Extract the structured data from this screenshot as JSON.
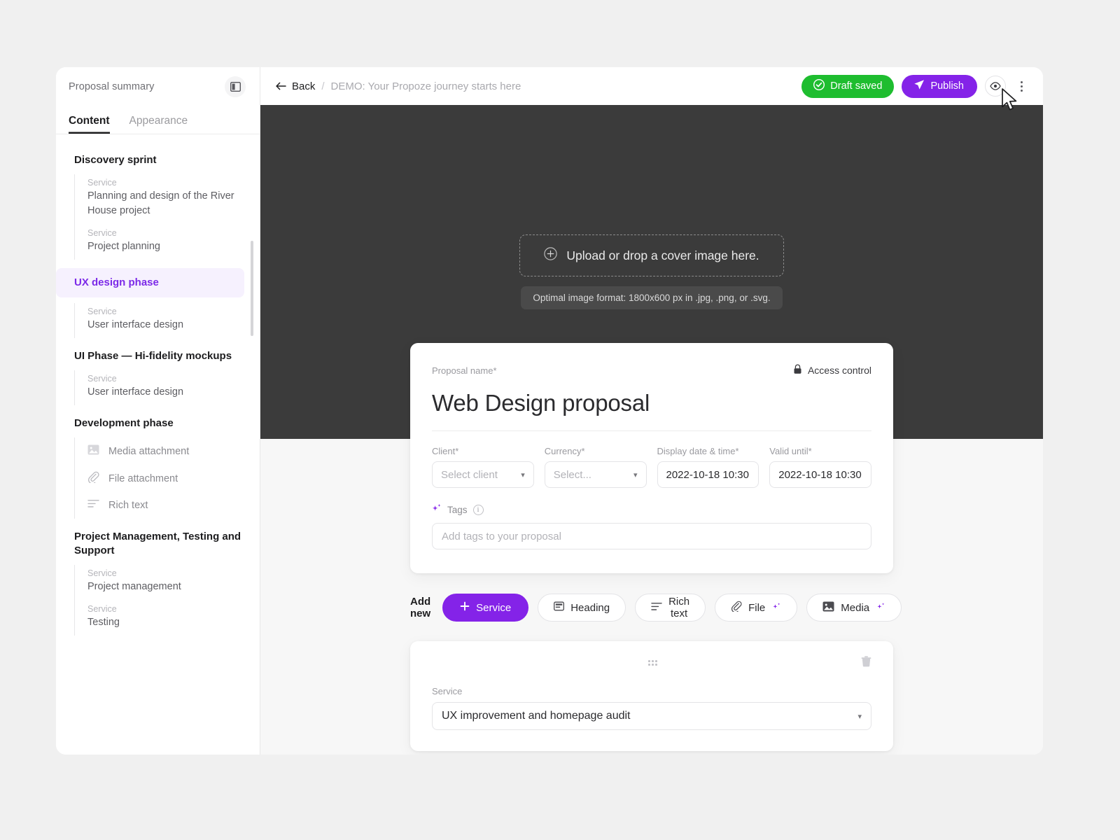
{
  "sidebar": {
    "title": "Proposal summary",
    "panel_toggle_icon": "panel-layout-icon",
    "tabs": [
      {
        "label": "Content",
        "active": true
      },
      {
        "label": "Appearance",
        "active": false
      }
    ],
    "groups": [
      {
        "title": "Discovery sprint",
        "active": false,
        "items": [
          {
            "kind": "Service",
            "name": "Planning and design of the River House project"
          },
          {
            "kind": "Service",
            "name": "Project planning"
          }
        ]
      },
      {
        "title": "UX design phase",
        "active": true,
        "items": [
          {
            "kind": "Service",
            "name": "User interface design"
          }
        ]
      },
      {
        "title": "UI Phase — Hi-fidelity mockups",
        "active": false,
        "items": [
          {
            "kind": "Service",
            "name": "User interface design"
          }
        ]
      },
      {
        "title": "Development phase",
        "active": false,
        "blocks": [
          {
            "icon": "image-icon",
            "label": "Media attachment"
          },
          {
            "icon": "paperclip-icon",
            "label": "File attachment"
          },
          {
            "icon": "text-lines-icon",
            "label": "Rich text"
          }
        ]
      },
      {
        "title": "Project Management, Testing and Support",
        "active": false,
        "items": [
          {
            "kind": "Service",
            "name": "Project management"
          },
          {
            "kind": "Service",
            "name": "Testing"
          }
        ]
      }
    ]
  },
  "topbar": {
    "back_label": "Back",
    "separator": "/",
    "breadcrumb_current": "DEMO: Your Propoze journey starts here",
    "draft_label": "Draft saved",
    "publish_label": "Publish",
    "preview_icon": "eye-icon",
    "more_icon": "kebab-menu-icon",
    "draft_color": "#1ebd2f",
    "publish_color": "#8423e8"
  },
  "cover": {
    "upload_label": "Upload or drop a cover image here.",
    "upload_icon": "plus-circle-icon",
    "hint": "Optimal image format: 1800x600 px in .jpg, .png, or .svg.",
    "background_color": "#3b3b3b"
  },
  "proposal": {
    "name_label": "Proposal name*",
    "name_value": "Web Design proposal",
    "access_control_label": "Access control",
    "access_control_icon": "lock-icon",
    "fields": [
      {
        "label": "Client*",
        "value": "Select client",
        "is_placeholder": true,
        "type": "select"
      },
      {
        "label": "Currency*",
        "value": "Select...",
        "is_placeholder": true,
        "type": "select"
      },
      {
        "label": "Display date & time*",
        "value": "2022-10-18 10:30",
        "is_placeholder": false,
        "type": "datetime"
      },
      {
        "label": "Valid until*",
        "value": "2022-10-18 10:30",
        "is_placeholder": false,
        "type": "datetime"
      }
    ],
    "tags_label": "Tags",
    "tags_icon": "sparkle-icon",
    "tags_info_icon": "info-icon",
    "tags_placeholder": "Add tags to your proposal"
  },
  "add_new": {
    "label": "Add new",
    "buttons": [
      {
        "label": "Service",
        "icon": "plus-icon",
        "primary": true,
        "ai": false
      },
      {
        "label": "Heading",
        "icon": "heading-icon",
        "primary": false,
        "ai": false
      },
      {
        "label": "Rich text",
        "icon": "text-lines-icon",
        "primary": false,
        "ai": false
      },
      {
        "label": "File",
        "icon": "paperclip-icon",
        "primary": false,
        "ai": true
      },
      {
        "label": "Media",
        "icon": "image-icon",
        "primary": false,
        "ai": true
      }
    ]
  },
  "service_card": {
    "drag_icon": "drag-handle-icon",
    "delete_icon": "trash-icon",
    "select_label": "Service",
    "select_value": "UX improvement and homepage audit"
  }
}
